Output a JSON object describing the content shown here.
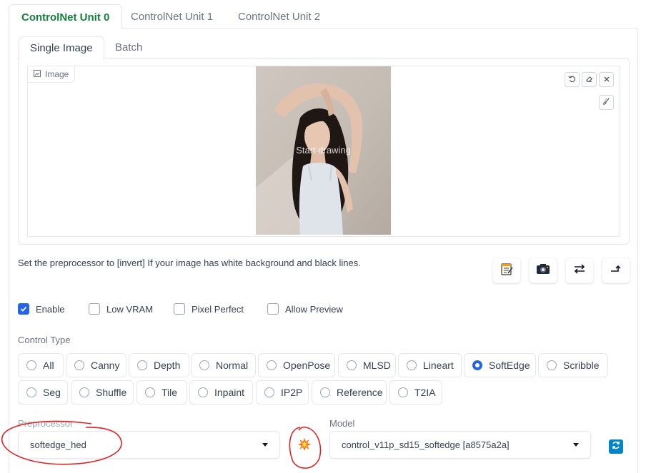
{
  "unit_tabs": [
    "ControlNet Unit 0",
    "ControlNet Unit 1",
    "ControlNet Unit 2"
  ],
  "mode_tabs": [
    "Single Image",
    "Batch"
  ],
  "image_panel": {
    "label": "Image",
    "overlay_text": "Start drawing",
    "tools": [
      "undo-icon",
      "eraser-icon",
      "close-icon",
      "brush-icon"
    ]
  },
  "hint": "Set the preprocessor to [invert] If your image has white background and black lines.",
  "action_icons": [
    "notepad-icon",
    "camera-icon",
    "swap-arrows-icon",
    "send-up-arrow-icon"
  ],
  "checkboxes": {
    "enable": {
      "label": "Enable",
      "checked": true
    },
    "low_vram": {
      "label": "Low VRAM",
      "checked": false
    },
    "pixel_perfect": {
      "label": "Pixel Perfect",
      "checked": false
    },
    "allow_preview": {
      "label": "Allow Preview",
      "checked": false
    }
  },
  "control_type": {
    "label": "Control Type",
    "selected": "SoftEdge",
    "options": [
      "All",
      "Canny",
      "Depth",
      "Normal",
      "OpenPose",
      "MLSD",
      "Lineart",
      "SoftEdge",
      "Scribble",
      "Seg",
      "Shuffle",
      "Tile",
      "Inpaint",
      "IP2P",
      "Reference",
      "T2IA"
    ]
  },
  "preprocessor": {
    "label": "Preprocessor",
    "value": "softedge_hed"
  },
  "run_preprocessor_icon": "explosion-icon",
  "model": {
    "label": "Model",
    "value": "control_v11p_sd15_softedge [a8575a2a]"
  },
  "refresh_icon": "refresh-icon",
  "colors": {
    "accent": "#2563eb",
    "active_tab": "#15803d",
    "annotation": "#dc2626"
  }
}
